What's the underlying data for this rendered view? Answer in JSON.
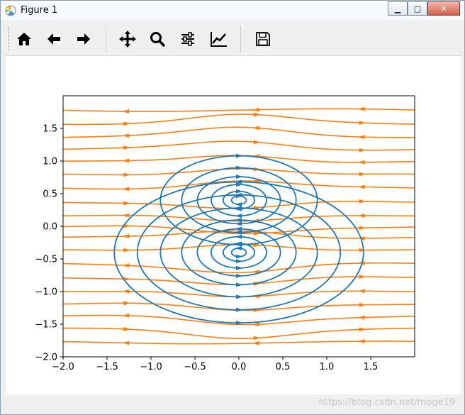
{
  "window": {
    "title": "Figure 1",
    "minimize_label": "▁",
    "maximize_label": "□",
    "close_label": "✕"
  },
  "toolbar": {
    "buttons": [
      {
        "name": "home",
        "icon": "home-icon"
      },
      {
        "name": "back",
        "icon": "arrow-left-icon"
      },
      {
        "name": "forward",
        "icon": "arrow-right-icon"
      },
      {
        "name": "pan",
        "icon": "move-icon"
      },
      {
        "name": "zoom",
        "icon": "magnifier-icon"
      },
      {
        "name": "configure-subplots",
        "icon": "sliders-icon"
      },
      {
        "name": "edit-axis",
        "icon": "line-chart-icon"
      },
      {
        "name": "save",
        "icon": "floppy-disk-icon"
      }
    ]
  },
  "status": {
    "watermark": "https://blog.csdn.net/moge19"
  },
  "colors": {
    "series_blue": "#1f77b4",
    "series_orange": "#ff7f0e"
  },
  "chart_data": {
    "type": "streamplot",
    "title": "",
    "xlabel": "",
    "ylabel": "",
    "xlim": [
      -2.0,
      2.0
    ],
    "ylim": [
      -2.0,
      2.0
    ],
    "x_ticks": [
      "−2.0",
      "−1.5",
      "−1.0",
      "−0.5",
      "0.0",
      "0.5",
      "1.0",
      "1.5"
    ],
    "x_tick_values": [
      -2.0,
      -1.5,
      -1.0,
      -0.5,
      0.0,
      0.5,
      1.0,
      1.5
    ],
    "y_ticks": [
      "−2.0",
      "−1.5",
      "−1.0",
      "−0.5",
      "0.0",
      "0.5",
      "1.0",
      "1.5"
    ],
    "y_tick_values": [
      -2.0,
      -1.5,
      -1.0,
      -0.5,
      0.0,
      0.5,
      1.0,
      1.5
    ],
    "grid": false,
    "series": [
      {
        "color": "#1f77b4",
        "centers": [
          [
            0.0,
            0.4
          ],
          [
            0.0,
            -0.4
          ]
        ],
        "radii_upper": [
          0.08,
          0.17,
          0.3,
          0.45,
          0.62,
          0.85
        ],
        "radii_lower": [
          0.08,
          0.17,
          0.3,
          0.45,
          0.62,
          0.85,
          1.1,
          1.35
        ]
      },
      {
        "color": "#ff7f0e",
        "y_values": [
          1.78,
          1.58,
          1.38,
          1.18,
          0.98,
          0.78,
          0.58,
          0.38,
          0.18,
          0.0,
          -0.18,
          -0.38,
          -0.58,
          -0.78,
          -0.98,
          -1.18,
          -1.38,
          -1.58,
          -1.78
        ]
      }
    ]
  }
}
